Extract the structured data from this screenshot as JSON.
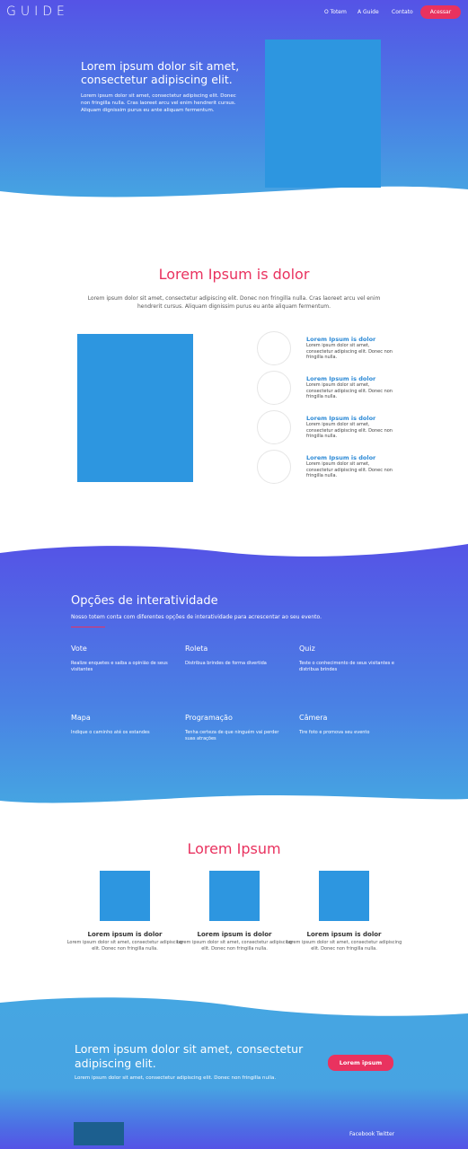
{
  "header": {
    "logo": "GUIDE",
    "nav": [
      "O Totem",
      "A Guide",
      "Contato"
    ],
    "cta": "Acessar"
  },
  "hero": {
    "title": "Lorem ipsum dolor sit amet, consectetur adipiscing elit.",
    "text": "Lorem ipsum dolor sit amet, consectetur adipiscing elit. Donec non fringilla nulla. Cras laoreet arcu vel enim hendrerit cursus. Aliquam dignissim purus eu ante aliquam fermentum."
  },
  "about": {
    "title": "Lorem Ipsum is dolor",
    "text": "Lorem ipsum dolor sit amet, consectetur adipiscing elit. Donec non fringilla nulla. Cras laoreet arcu vel enim hendrerit cursus. Aliquam dignissim purus eu ante aliquam fermentum.",
    "features": [
      {
        "title": "Lorem Ipsum is dolor",
        "text": "Lorem ipsum dolor sit amet, consectetur adipiscing elit. Donec non fringilla nulla."
      },
      {
        "title": "Lorem Ipsum is dolor",
        "text": "Lorem ipsum dolor sit amet, consectetur adipiscing elit. Donec non fringilla nulla."
      },
      {
        "title": "Lorem Ipsum is dolor",
        "text": "Lorem ipsum dolor sit amet, consectetur adipiscing elit. Donec non fringilla nulla."
      },
      {
        "title": "Lorem Ipsum is dolor",
        "text": "Lorem ipsum dolor sit amet, consectetur adipiscing elit. Donec non fringilla nulla."
      }
    ]
  },
  "interactivity": {
    "title": "Opções de interatividade",
    "subtitle": "Nosso totem conta com diferentes opções de interatividade para acrescentar ao seu evento.",
    "options": [
      {
        "title": "Vote",
        "text": "Realize enquetes e saiba a opinião de seus visitantes"
      },
      {
        "title": "Roleta",
        "text": "Distribua brindes de forma divertida"
      },
      {
        "title": "Quiz",
        "text": "Teste o conhecimento de seus visitantes e distribua brindes"
      },
      {
        "title": "Mapa",
        "text": "Indique o caminho até os estandes"
      },
      {
        "title": "Programação",
        "text": "Tenha certeza de que ninguém vai perder suas atrações"
      },
      {
        "title": "Câmera",
        "text": "Tire foto e promova seu evento"
      }
    ]
  },
  "cards": {
    "title": "Lorem Ipsum",
    "items": [
      {
        "title": "Lorem ipsum is dolor",
        "text": "Lorem ipsum dolor sit amet, consectetur adipiscing elit. Donec non fringilla nulla."
      },
      {
        "title": "Lorem ipsum is dolor",
        "text": "Lorem ipsum dolor sit amet, consectetur adipiscing elit. Donec non fringilla nulla."
      },
      {
        "title": "Lorem ipsum is dolor",
        "text": "Lorem ipsum dolor sit amet, consectetur adipiscing elit. Donec non fringilla nulla."
      }
    ]
  },
  "cta": {
    "title": "Lorem ipsum dolor sit amet, consectetur adipiscing elit.",
    "text": "Lorem ipsum dolor sit amet, consectetur adipiscing elit. Donec non fringilla nulla.",
    "button": "Lorem ipsum"
  },
  "footer": {
    "links": [
      "Facebook",
      "Twitter"
    ]
  },
  "colors": {
    "accent": "#e9325f",
    "primary_blue": "#2d96e0",
    "gradient_top": "#5553e6",
    "gradient_bottom": "#45a6e2"
  }
}
